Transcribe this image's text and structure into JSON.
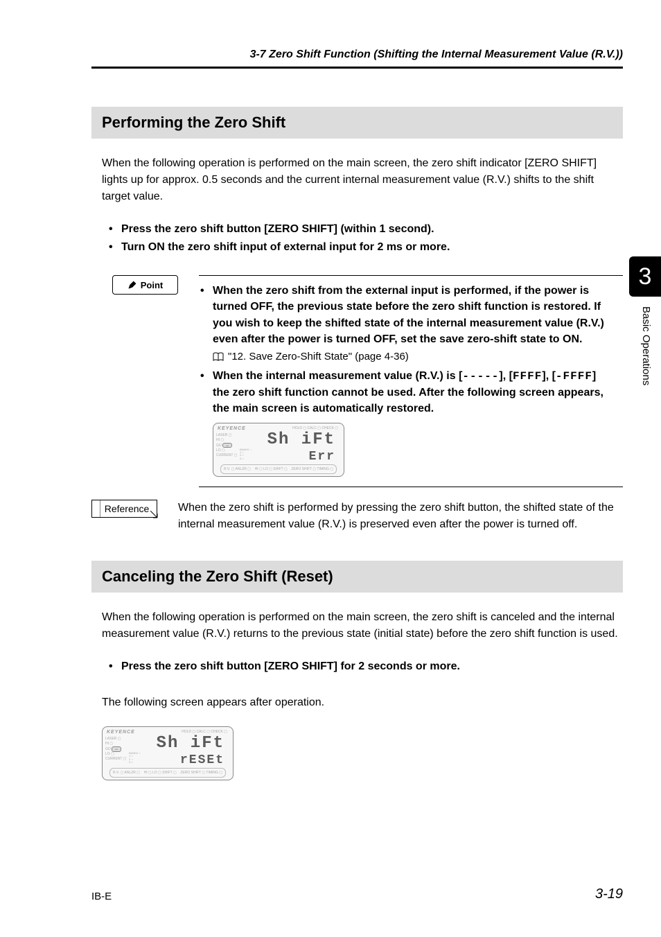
{
  "header": {
    "section_title": "3-7  Zero Shift Function (Shifting the Internal Measurement Value (R.V.))"
  },
  "chapter": {
    "number": "3",
    "side_label": "Basic Operations"
  },
  "section1": {
    "heading": "Performing the Zero Shift",
    "intro": "When the following operation is performed on the main screen, the zero shift indicator [ZERO SHIFT] lights up for approx. 0.5 seconds and the current internal measurement value (R.V.) shifts to the shift target value.",
    "bullet1": "Press the zero shift button [ZERO SHIFT] (within 1 second).",
    "bullet2": "Turn ON the zero shift input of external input for 2 ms or more."
  },
  "point": {
    "label": "Point",
    "bullet1": "When the zero shift from the external input is performed, if the power is turned OFF, the previous state before the zero shift function is restored. If you wish to keep the shifted state of the internal measurement value (R.V.) even after the power is turned OFF, set the save zero-shift state to ON.",
    "bookref": "\"12. Save Zero-Shift State\" (page 4-36)",
    "bullet2_pre": "When the internal measurement value (R.V.) is [",
    "bullet2_dashes": "-----",
    "bullet2_mid1": "], [",
    "bullet2_ffff1": "FFFF",
    "bullet2_mid2": "], [",
    "bullet2_negffff": "-FFFF",
    "bullet2_post": "] the zero shift function cannot be used. After the following screen appears, the main screen is automatically restored."
  },
  "device1": {
    "brand": "KEYENCE",
    "top_labels": "HOLD ▢ CALC ▢ CHECK ▢",
    "left_laser": "LASER ▢",
    "left_hi": "HI ▢",
    "left_go": "GO",
    "left_lo": "LO ▢",
    "left_current": "CURRENT ▢",
    "bank_label": "BANK0 ○",
    "bank_nums": "1 ○\n2 ○\n3 ○",
    "main_text": "Sh iFt",
    "sub_text": "Err",
    "bottom_left": "R.V. ▢ ANLZR ▢",
    "bottom_mid": "HI ▢   LO ▢ SHIFT ▢",
    "bottom_right": "ZERO SHIFT ▢   TIMING ▢"
  },
  "reference": {
    "label": "Reference",
    "text": "When the zero shift is performed by pressing the zero shift button, the shifted state of the internal measurement value (R.V.) is preserved even after the power is turned off."
  },
  "section2": {
    "heading": "Canceling the Zero Shift (Reset)",
    "intro": "When the following operation is performed on the main screen, the zero shift is canceled and the internal measurement value (R.V.) returns to the previous state (initial state) before the zero shift function is used.",
    "bullet1": "Press the zero shift button [ZERO SHIFT] for 2 seconds or more.",
    "outro": "The following screen appears after operation."
  },
  "device2": {
    "main_text": "Sh iFt",
    "sub_text": "rESEt"
  },
  "footer": {
    "left": "IB-E",
    "right": "3-19"
  }
}
